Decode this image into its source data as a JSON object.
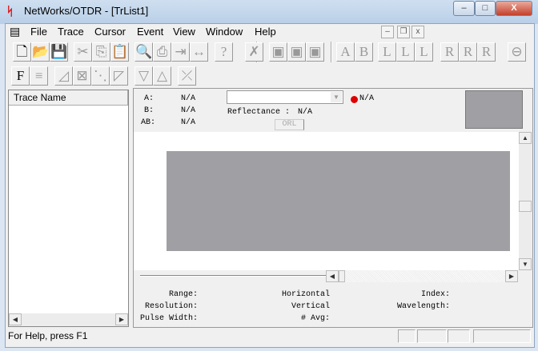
{
  "window": {
    "title": "NetWorks/OTDR - [TrList1]",
    "app_icon": "otdr-logo-icon",
    "minimize": "–",
    "maximize": "□",
    "close": "X"
  },
  "menu": {
    "items": [
      "File",
      "Trace",
      "Cursor",
      "Event",
      "View",
      "Window",
      "Help"
    ],
    "mdi": {
      "minimize": "–",
      "restore": "❐",
      "close": "x"
    }
  },
  "toolbar1": [
    {
      "name": "new-icon",
      "glyph": "🗋",
      "on": true
    },
    {
      "name": "open-icon",
      "glyph": "📂",
      "on": true
    },
    {
      "name": "save-icon",
      "glyph": "💾",
      "on": true
    },
    {
      "name": "cut-icon",
      "glyph": "✂"
    },
    {
      "name": "copy-icon",
      "glyph": "⎘"
    },
    {
      "name": "paste-icon",
      "glyph": "📋"
    },
    {
      "name": "print-preview-icon",
      "glyph": "🔍"
    },
    {
      "name": "print-icon",
      "glyph": "⎙"
    },
    {
      "name": "export-icon",
      "glyph": "⇥"
    },
    {
      "name": "fit-icon",
      "glyph": "↔"
    },
    {
      "name": "context-help-icon",
      "glyph": "?"
    },
    {
      "name": "event-icon",
      "glyph": "✗"
    },
    {
      "name": "marker-a-icon",
      "glyph": "▣"
    },
    {
      "name": "marker-b-icon",
      "glyph": "▣"
    },
    {
      "name": "marker-c-icon",
      "glyph": "▣"
    },
    {
      "name": "cursor-a-icon",
      "glyph": "A"
    },
    {
      "name": "cursor-b-icon",
      "glyph": "B"
    },
    {
      "name": "left-1-icon",
      "glyph": "L"
    },
    {
      "name": "left-2-icon",
      "glyph": "L"
    },
    {
      "name": "left-3-icon",
      "glyph": "L"
    },
    {
      "name": "right-1-icon",
      "glyph": "R"
    },
    {
      "name": "right-2-icon",
      "glyph": "R"
    },
    {
      "name": "right-3-icon",
      "glyph": "R"
    },
    {
      "name": "zoom-icon",
      "glyph": "⊖"
    }
  ],
  "toolbar2": [
    {
      "name": "trace-file-icon",
      "glyph": "F",
      "on": true
    },
    {
      "name": "list-icon",
      "glyph": "≡"
    },
    {
      "name": "event-1-icon",
      "glyph": "◿"
    },
    {
      "name": "event-2-icon",
      "glyph": "⊠"
    },
    {
      "name": "event-3-icon",
      "glyph": "⋱"
    },
    {
      "name": "event-4-icon",
      "glyph": "◸"
    },
    {
      "name": "splice-down-icon",
      "glyph": "▽"
    },
    {
      "name": "splice-up-icon",
      "glyph": "△"
    },
    {
      "name": "end-icon",
      "glyph": "⤫"
    }
  ],
  "trace_list": {
    "header": "Trace Name"
  },
  "info": {
    "a_label": "A:",
    "a_value": "N/A",
    "b_label": "B:",
    "b_value": "N/A",
    "ab_label": "AB:",
    "ab_value": "N/A",
    "status_value": "N/A",
    "status_color": "#dd0000",
    "reflectance_label": "Reflectance :",
    "reflectance_value": "N/A",
    "orl_button": "ORL"
  },
  "params": {
    "range": "Range:",
    "resolution": "Resolution:",
    "pulse_width": "Pulse Width:",
    "horizontal": "Horizontal",
    "vertical": "Vertical",
    "avg": "# Avg:",
    "index": "Index:",
    "wavelength": "Wavelength:"
  },
  "statusbar": {
    "text": "For Help, press F1"
  }
}
